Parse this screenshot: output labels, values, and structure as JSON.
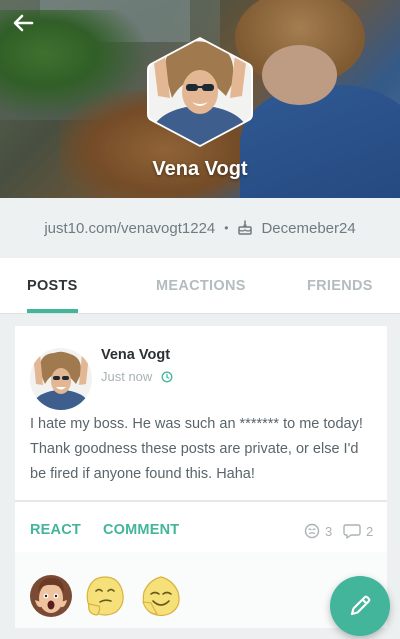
{
  "profile": {
    "name": "Vena Vogt",
    "website": "just10.com/venavogt1224",
    "separator": "•",
    "birthday": "Decemeber24"
  },
  "tabs": [
    {
      "label": "POSTS",
      "active": true
    },
    {
      "label": "MEACTIONS",
      "active": false
    },
    {
      "label": "FRIENDS",
      "active": false
    }
  ],
  "post": {
    "author": "Vena Vogt",
    "time": "Just now",
    "text": "I hate my boss. He was such an ******* to me today! Thank goodness these posts are private, or else I'd be fired if anyone found this. Haha!",
    "actions": {
      "react": "REACT",
      "comment": "COMMENT"
    },
    "stats": {
      "reactions": "3",
      "comments": "2"
    }
  },
  "icons": {
    "back": "arrow-left-icon",
    "birthday": "cake-icon",
    "time": "clock-icon",
    "reactions": "smiley-icon",
    "comments": "chat-bubble-icon",
    "compose": "pencil-icon"
  },
  "colors": {
    "accent": "#43b59b",
    "text_dark": "#2e3438",
    "text_muted": "#a9b3b6"
  }
}
